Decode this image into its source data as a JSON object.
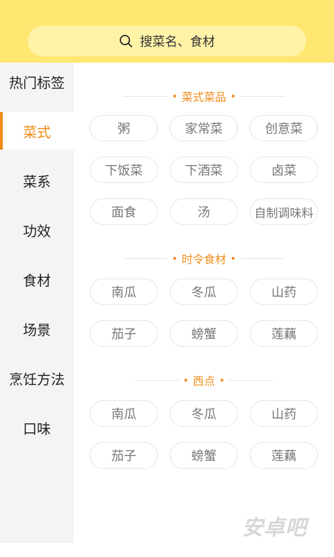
{
  "search": {
    "placeholder": "搜菜名、食材",
    "icon": "search-icon"
  },
  "sidebar": {
    "items": [
      {
        "label": "热门标签",
        "active": false
      },
      {
        "label": "菜式",
        "active": true
      },
      {
        "label": "菜系",
        "active": false
      },
      {
        "label": "功效",
        "active": false
      },
      {
        "label": "食材",
        "active": false
      },
      {
        "label": "场景",
        "active": false
      },
      {
        "label": "烹饪方法",
        "active": false
      },
      {
        "label": "口味",
        "active": false
      }
    ]
  },
  "sections": [
    {
      "title": "菜式菜品",
      "chips": [
        "粥",
        "家常菜",
        "创意菜",
        "下饭菜",
        "下酒菜",
        "卤菜",
        "面食",
        "汤",
        "自制调味料"
      ]
    },
    {
      "title": "时令食材",
      "chips": [
        "南瓜",
        "冬瓜",
        "山药",
        "茄子",
        "螃蟹",
        "莲藕"
      ]
    },
    {
      "title": "西点",
      "chips": [
        "南瓜",
        "冬瓜",
        "山药",
        "茄子",
        "螃蟹",
        "莲藕"
      ]
    }
  ],
  "watermark": "安卓吧",
  "colors": {
    "header": "#ffe771",
    "search_bg": "#fff3a8",
    "accent": "#f08c1a",
    "sidebar_bg": "#f4f4f4",
    "chip_text": "#777777",
    "chip_border": "#e6e6e6"
  }
}
